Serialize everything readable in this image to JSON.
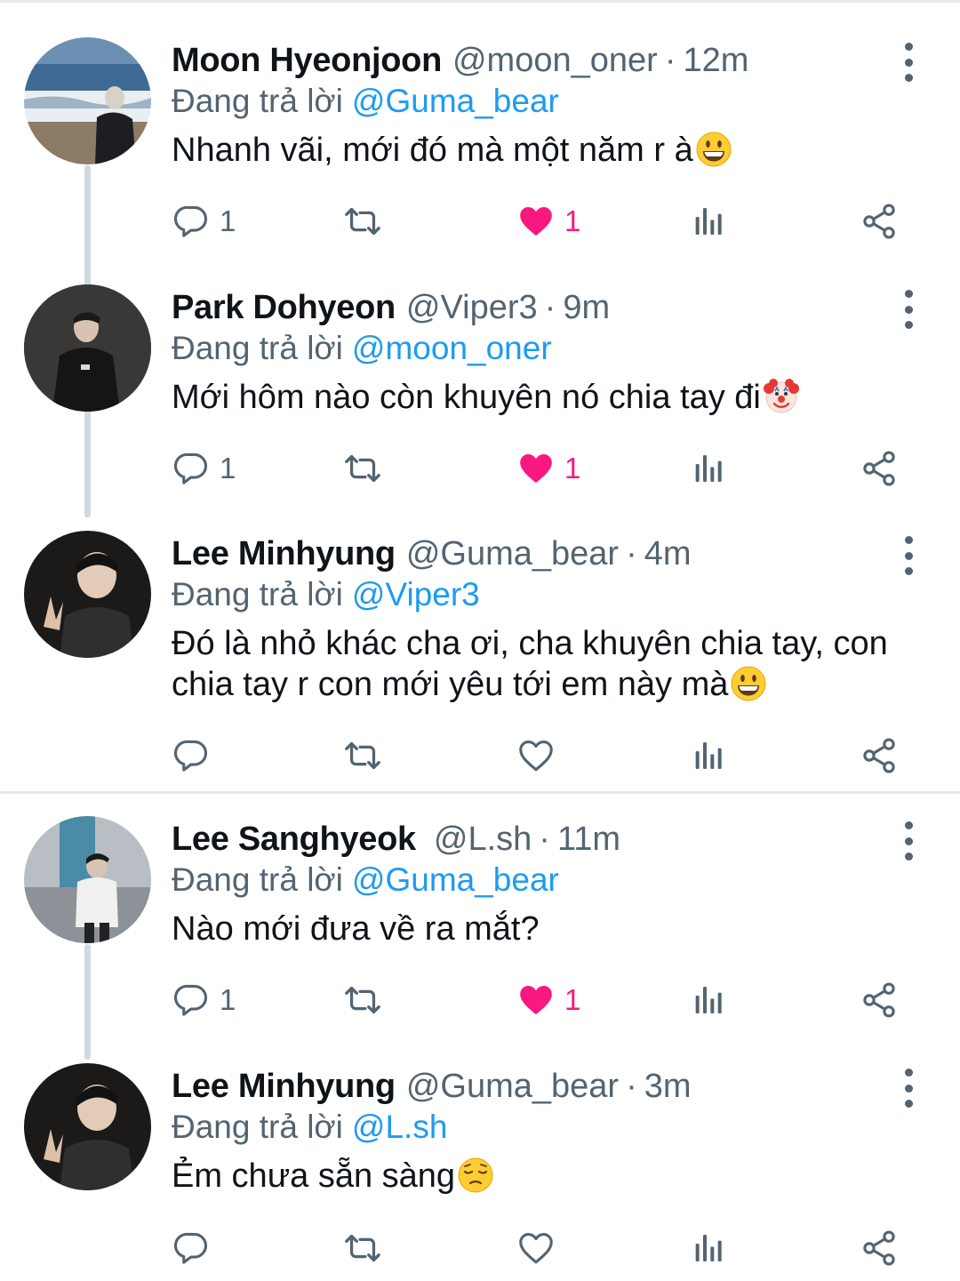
{
  "reply_prefix": "Đang trả lời",
  "colors": {
    "link": "#1d9bf0",
    "like_active": "#f91880",
    "muted": "#536471",
    "thread_line": "#cfd9de"
  },
  "tweets": [
    {
      "name": "Moon Hyeonjoon",
      "handle": "@moon_oner",
      "time": "12m",
      "reply_to": "@Guma_bear",
      "text": "Nhanh vãi, mới đó mà một năm r à",
      "emoji": "grinning-face",
      "reply_count": "1",
      "like_count": "1",
      "liked": true
    },
    {
      "name": "Park Dohyeon",
      "handle": "@Viper3",
      "time": "9m",
      "reply_to": "@moon_oner",
      "text": "Mới hôm nào còn khuyên nó chia tay đi",
      "emoji": "clown-face",
      "reply_count": "1",
      "like_count": "1",
      "liked": true
    },
    {
      "name": "Lee Minhyung",
      "handle": "@Guma_bear",
      "time": "4m",
      "reply_to": "@Viper3",
      "text_line1": "Đó là nhỏ khác cha ơi, cha khuyên chia tay, con",
      "text_line2": "chia tay r con mới yêu tới em này mà",
      "emoji": "grinning-face",
      "reply_count": "",
      "like_count": "",
      "liked": false
    },
    {
      "name": "Lee Sanghyeok",
      "handle": "@L.sh",
      "time": "11m",
      "reply_to": "@Guma_bear",
      "text": "Nào mới đưa về ra mắt?",
      "emoji": "",
      "reply_count": "1",
      "like_count": "1",
      "liked": true
    },
    {
      "name": "Lee Minhyung",
      "handle": "@Guma_bear",
      "time": "3m",
      "reply_to": "@L.sh",
      "text": "Ẻm chưa sẵn sàng",
      "emoji": "pensive-face",
      "reply_count": "",
      "like_count": "",
      "liked": false
    }
  ]
}
